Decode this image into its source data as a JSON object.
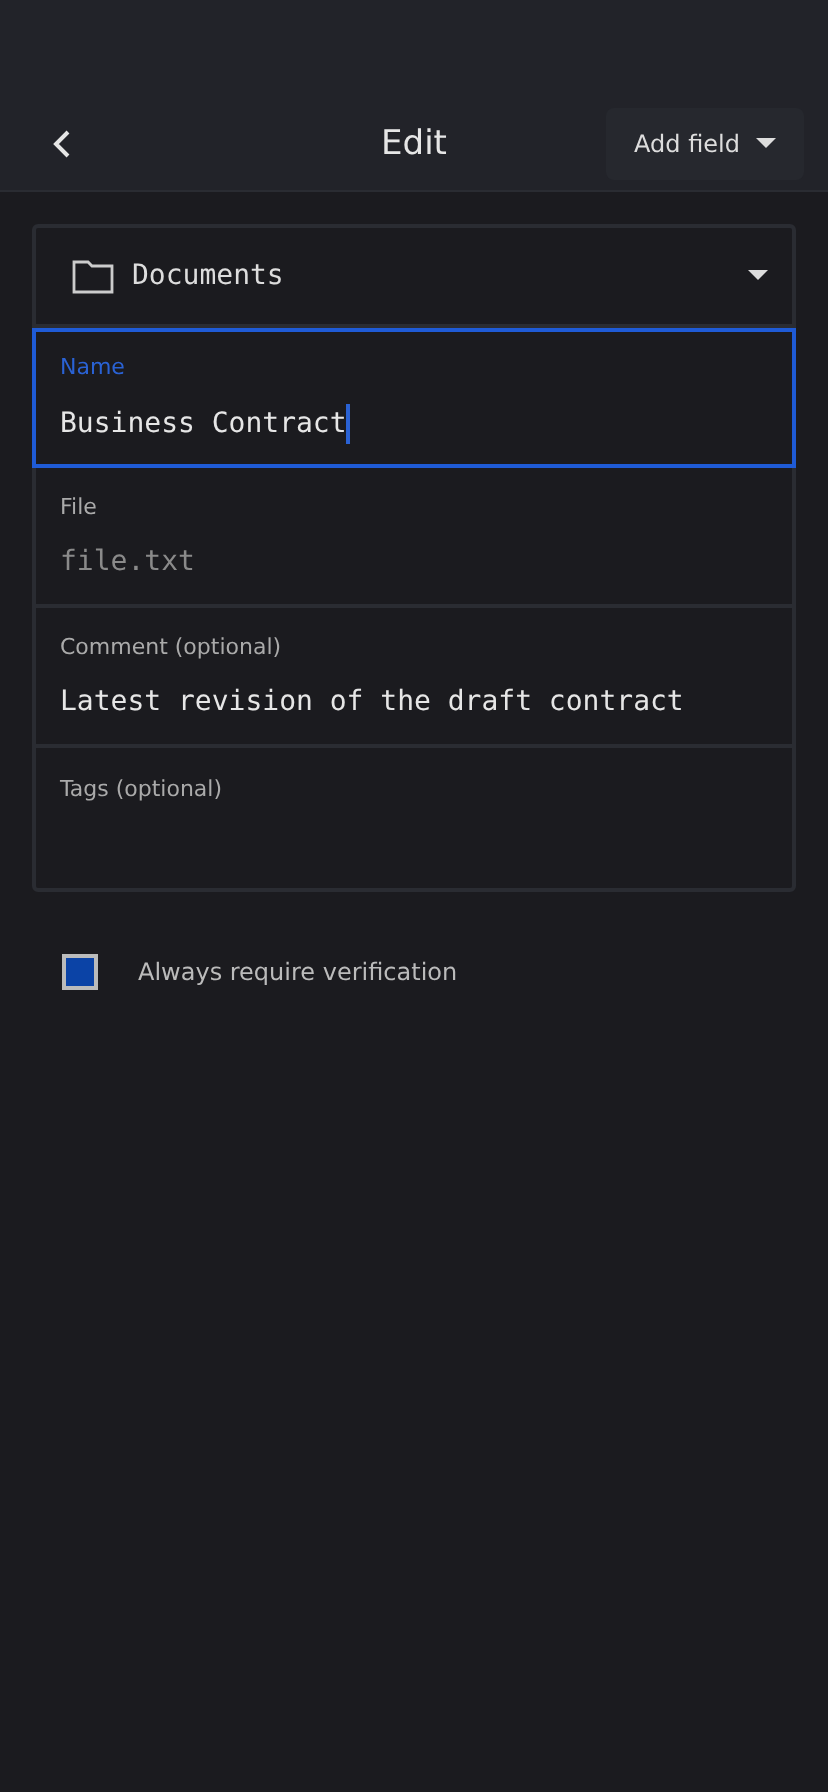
{
  "header": {
    "title": "Edit",
    "add_button": "Add field"
  },
  "folder": {
    "value": "Documents"
  },
  "fields": [
    {
      "label": "Name",
      "value": "Business Contract",
      "focused": true
    },
    {
      "label": "File",
      "placeholder": "file.txt",
      "focused": false
    },
    {
      "label": "Comment (optional)",
      "value": "Latest revision of the draft contract",
      "focused": false
    },
    {
      "label": "Tags (optional)",
      "focused": false
    }
  ],
  "verification": {
    "label": "Always require verification",
    "checked": true
  }
}
